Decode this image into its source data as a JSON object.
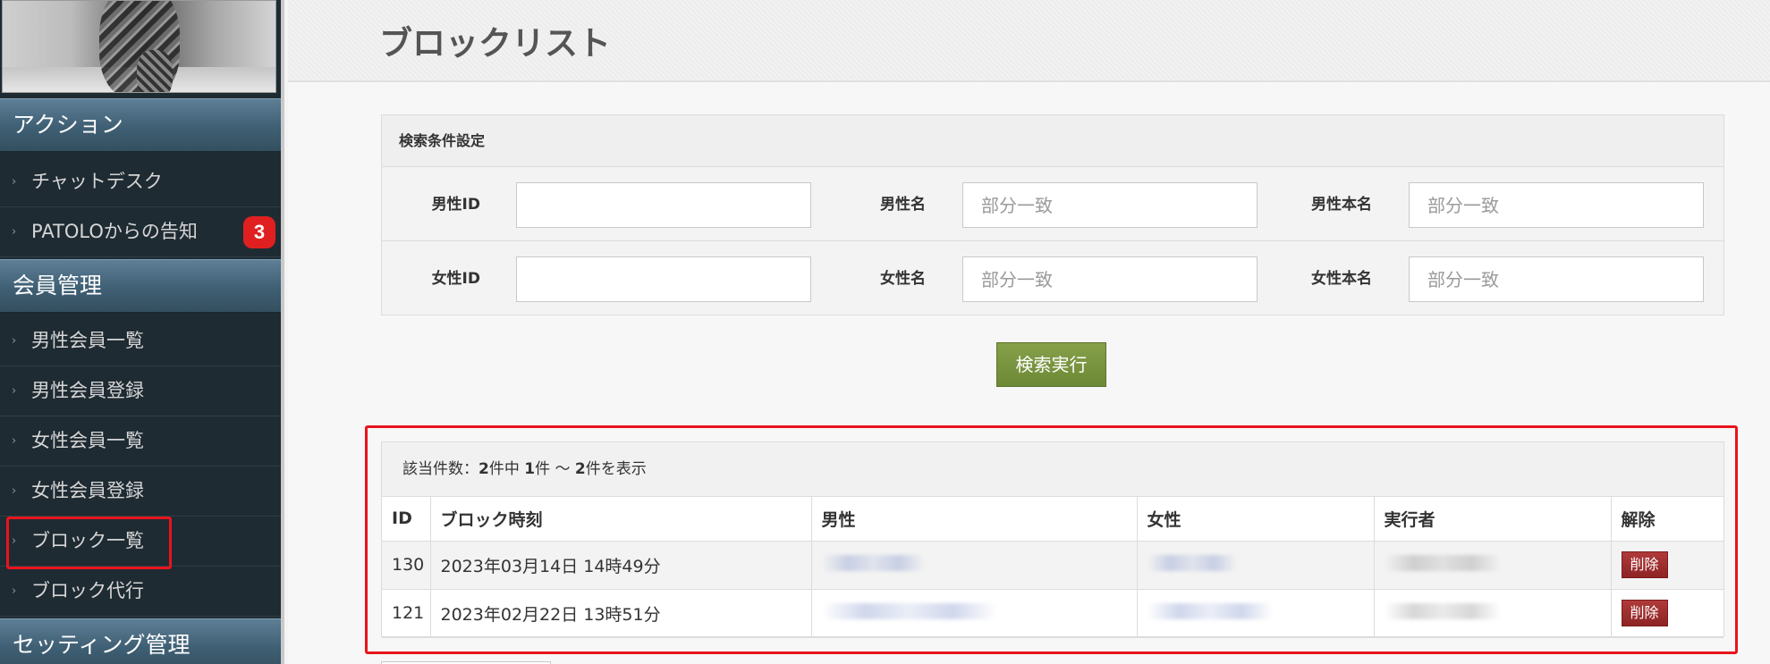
{
  "sidebar": {
    "sections": [
      {
        "title": "アクション",
        "items": [
          {
            "label": "チャットデスク"
          },
          {
            "label": "PATOLOからの告知",
            "badge": "3"
          }
        ]
      },
      {
        "title": "会員管理",
        "items": [
          {
            "label": "男性会員一覧"
          },
          {
            "label": "男性会員登録"
          },
          {
            "label": "女性会員一覧"
          },
          {
            "label": "女性会員登録"
          },
          {
            "label": "ブロック一覧",
            "highlighted": true
          },
          {
            "label": "ブロック代行"
          }
        ]
      },
      {
        "title": "セッティング管理",
        "items": []
      }
    ]
  },
  "page": {
    "title": "ブロックリスト"
  },
  "search": {
    "heading": "検索条件設定",
    "fields": {
      "male_id": {
        "label": "男性ID",
        "value": "",
        "placeholder": ""
      },
      "male_name": {
        "label": "男性名",
        "value": "",
        "placeholder": "部分一致"
      },
      "male_real_name": {
        "label": "男性本名",
        "value": "",
        "placeholder": "部分一致"
      },
      "female_id": {
        "label": "女性ID",
        "value": "",
        "placeholder": ""
      },
      "female_name": {
        "label": "女性名",
        "value": "",
        "placeholder": "部分一致"
      },
      "female_real_name": {
        "label": "女性本名",
        "value": "",
        "placeholder": "部分一致"
      }
    },
    "submit_label": "検索実行"
  },
  "results": {
    "count": {
      "prefix": "該当件数：",
      "total": "2",
      "mid1": "件中 ",
      "from": "1",
      "mid2": "件 ～ ",
      "to": "2",
      "suffix": "件を表示"
    },
    "columns": [
      "ID",
      "ブロック時刻",
      "男性",
      "女性",
      "実行者",
      "解除"
    ],
    "rows": [
      {
        "id": "130",
        "time": "2023年03月14日 14時49分",
        "male": "(blurred)",
        "female": "(blurred)",
        "executor": "(blurred)",
        "action": "削除"
      },
      {
        "id": "121",
        "time": "2023年02月22日 13時51分",
        "male": "(blurred)",
        "female": "(blurred)",
        "executor": "(blurred)",
        "action": "削除"
      }
    ]
  },
  "colors": {
    "sidebar_bg": "#1f2b33",
    "sidebar_header": "#3f5f74",
    "badge": "#e02020",
    "submit_button": "#7a9640",
    "delete_button": "#9c2e2e",
    "highlight_border": "#e8141c"
  }
}
